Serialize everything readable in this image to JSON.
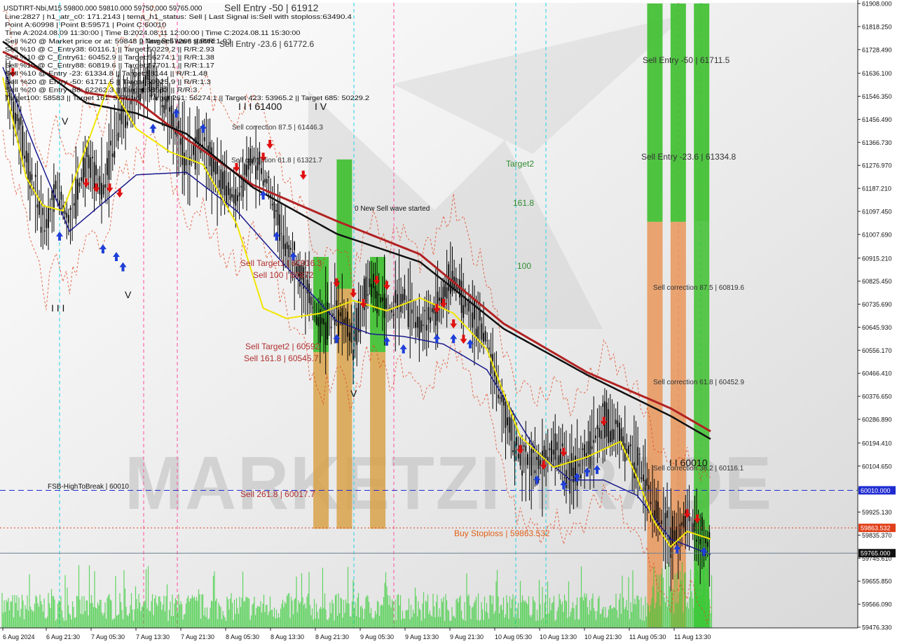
{
  "chart_data": {
    "type": "candlestick",
    "symbol": "USDTIRT-Nbi",
    "timeframe": "M15",
    "ohlc_header": "USDTIRT-Nbi,M15  59800.000 59810.000 59750.000 59765.000",
    "info_lines": [
      "Line:2827  | h1_atr_c0: 171.2143  | tema_h1_status: Sell  | Last Signal is:Sell with stoploss:63490.4",
      "Point A:60998  | Point B:59571  | Point C:60010",
      "Time A:2024.08.09 11:30:00  | Time B:2024.08.11 12:00:00  | Time C:2024.08.11 15:30:00",
      "Sell %20 @ Market price or at: 59848  || Target:57266  || R/R:1.93",
      "Sell %10 @ C_Entry38: 60116.1  || Target:50229.2  || R/R:2.93",
      "Sell %10 @ C_Entry61: 60452.9  || Target:56274.1  || R/R:1.38",
      "Sell %10 @ C_Entry88: 60819.6  || Target:57701.1  || R/R:1.17",
      "Sell %10 @ Entry -23: 61334.8  || Target:58144  || R/R:1.48",
      "Sell %20 @ Entry -50: 61711.5  || Target:59025.9  || R/R:1.3",
      "Sell %20 @ Entry -88: 62262.3  || Target:58583  || R/R:3",
      "Target100: 58583  || Target 161: 57701.1  || Target 261: 56274.1  || Target 423: 53965.2  || Target 685: 50229.2"
    ],
    "y_ticks": [
      "61908.000",
      "61818.250",
      "61728.490",
      "61636.100",
      "61546.350",
      "61456.490",
      "61366.730",
      "61276.970",
      "61187.210",
      "61097.450",
      "61007.690",
      "60915.210",
      "60825.450",
      "60735.690",
      "60645.930",
      "60556.170",
      "60466.410",
      "60376.650",
      "60286.890",
      "60194.410",
      "60104.650",
      "60014.890",
      "59925.130",
      "59835.370",
      "59745.610",
      "59655.850",
      "59566.090",
      "59476.330"
    ],
    "ylim": [
      59476.33,
      61908.0
    ],
    "x_ticks": [
      "6 Aug 2024",
      "6 Aug 21:30",
      "7 Aug 05:30",
      "7 Aug 13:30",
      "7 Aug 21:30",
      "8 Aug 05:30",
      "8 Aug 13:30",
      "8 Aug 21:30",
      "9 Aug 05:30",
      "9 Aug 13:30",
      "9 Aug 21:30",
      "10 Aug 05:30",
      "10 Aug 13:30",
      "10 Aug 21:30",
      "11 Aug 05:30",
      "11 Aug 13:30"
    ],
    "price_badges": [
      {
        "value": 60010.0,
        "label": "60010.000",
        "color": "#1f2bd1"
      },
      {
        "value": 59863.532,
        "label": "59863.532",
        "color": "#e0401a"
      },
      {
        "value": 59765.0,
        "label": "59765.000",
        "color": "#111111"
      }
    ],
    "horizontal_lines": [
      {
        "value": 60010.0,
        "color": "#1f2bd1",
        "style": "dashed"
      },
      {
        "value": 59863.532,
        "color": "#e0401a",
        "style": "dotted"
      },
      {
        "value": 59765.0,
        "color": "#6b7f8f",
        "style": "solid"
      }
    ],
    "price_path": [
      [
        0,
        61640
      ],
      [
        0.05,
        61420
      ],
      [
        0.1,
        61150
      ],
      [
        0.13,
        61020
      ],
      [
        0.16,
        61200
      ],
      [
        0.2,
        61050
      ],
      [
        0.25,
        61300
      ],
      [
        0.3,
        61180
      ],
      [
        0.35,
        61480
      ],
      [
        0.4,
        61550
      ],
      [
        0.45,
        61620
      ],
      [
        0.5,
        61480
      ],
      [
        0.55,
        61300
      ],
      [
        0.6,
        61360
      ],
      [
        0.65,
        61210
      ],
      [
        0.7,
        61150
      ],
      [
        0.75,
        61320
      ],
      [
        0.8,
        61180
      ],
      [
        0.85,
        60950
      ],
      [
        0.9,
        60820
      ],
      [
        0.95,
        60650
      ],
      [
        1.0,
        60720
      ],
      [
        1.05,
        60600
      ],
      [
        1.1,
        60830
      ],
      [
        1.15,
        60700
      ],
      [
        1.2,
        60760
      ],
      [
        1.25,
        60650
      ],
      [
        1.3,
        60720
      ],
      [
        1.35,
        60850
      ],
      [
        1.4,
        60700
      ],
      [
        1.45,
        60600
      ],
      [
        1.5,
        60320
      ],
      [
        1.55,
        60150
      ],
      [
        1.6,
        60100
      ],
      [
        1.65,
        60180
      ],
      [
        1.7,
        60080
      ],
      [
        1.75,
        60150
      ],
      [
        1.8,
        60280
      ],
      [
        1.85,
        60220
      ],
      [
        1.9,
        60120
      ],
      [
        1.95,
        59950
      ],
      [
        2.0,
        59820
      ],
      [
        2.05,
        59900
      ],
      [
        2.1,
        59810
      ],
      [
        2.12,
        59765
      ]
    ],
    "ma_black": [
      [
        0,
        61760
      ],
      [
        0.25,
        61520
      ],
      [
        0.4,
        61480
      ],
      [
        0.55,
        61400
      ],
      [
        0.75,
        61190
      ],
      [
        1.0,
        61010
      ],
      [
        1.25,
        60900
      ],
      [
        1.5,
        60640
      ],
      [
        1.75,
        60460
      ],
      [
        2.0,
        60300
      ],
      [
        2.12,
        60210
      ]
    ],
    "ma_red": [
      [
        0,
        61720
      ],
      [
        0.25,
        61560
      ],
      [
        0.4,
        61530
      ],
      [
        0.55,
        61380
      ],
      [
        0.75,
        61200
      ],
      [
        1.0,
        61060
      ],
      [
        1.25,
        60930
      ],
      [
        1.5,
        60660
      ],
      [
        1.75,
        60470
      ],
      [
        2.0,
        60330
      ],
      [
        2.12,
        60240
      ]
    ],
    "ma_navy": [
      [
        0,
        61660
      ],
      [
        0.1,
        61330
      ],
      [
        0.2,
        61020
      ],
      [
        0.3,
        61130
      ],
      [
        0.4,
        61240
      ],
      [
        0.55,
        61250
      ],
      [
        0.7,
        61100
      ],
      [
        0.85,
        60880
      ],
      [
        1.0,
        60670
      ],
      [
        1.1,
        60620
      ],
      [
        1.2,
        60610
      ],
      [
        1.32,
        60580
      ],
      [
        1.45,
        60480
      ],
      [
        1.6,
        60160
      ],
      [
        1.7,
        60050
      ],
      [
        1.8,
        60050
      ],
      [
        1.9,
        59990
      ],
      [
        2.0,
        59820
      ],
      [
        2.12,
        59760
      ]
    ],
    "ma_yellow": [
      [
        0,
        61620
      ],
      [
        0.07,
        61230
      ],
      [
        0.12,
        61120
      ],
      [
        0.18,
        61100
      ],
      [
        0.25,
        61350
      ],
      [
        0.32,
        61600
      ],
      [
        0.4,
        61420
      ],
      [
        0.5,
        61330
      ],
      [
        0.6,
        61280
      ],
      [
        0.7,
        61050
      ],
      [
        0.78,
        60720
      ],
      [
        0.85,
        60680
      ],
      [
        0.95,
        60700
      ],
      [
        1.05,
        60750
      ],
      [
        1.15,
        60710
      ],
      [
        1.25,
        60760
      ],
      [
        1.35,
        60700
      ],
      [
        1.45,
        60560
      ],
      [
        1.55,
        60220
      ],
      [
        1.65,
        60100
      ],
      [
        1.75,
        60140
      ],
      [
        1.85,
        60200
      ],
      [
        1.9,
        60060
      ],
      [
        1.95,
        59890
      ],
      [
        2.0,
        59790
      ],
      [
        2.05,
        59850
      ],
      [
        2.12,
        59820
      ]
    ],
    "zones": [
      {
        "x0": 0.93,
        "x1": 1.0,
        "v0": 59860,
        "v1": 60920,
        "colors": [
          "#3dbf2e",
          "#d8a24a"
        ]
      },
      {
        "x0": 1.0,
        "x1": 1.1,
        "v0": 59860,
        "v1": 61300,
        "colors": [
          "#3dbf2e",
          "#d8a24a"
        ]
      },
      {
        "x0": 1.1,
        "x1": 1.18,
        "v0": 59860,
        "v1": 60920,
        "colors": [
          "#3dbf2e",
          "#d8a24a"
        ]
      },
      {
        "x0": 1.93,
        "x1": 2.0,
        "v0": 59476,
        "v1": 61908,
        "colors": [
          "#3dbf2e",
          "#e8975a"
        ]
      },
      {
        "x0": 2.0,
        "x1": 2.07,
        "v0": 59476,
        "v1": 61908,
        "colors": [
          "#3dbf2e",
          "#e8975a"
        ]
      },
      {
        "x0": 2.07,
        "x1": 2.13,
        "v0": 59476,
        "v1": 61908,
        "colors": [
          "#3dbf2e",
          "#3dbf2e"
        ]
      }
    ],
    "annotations": [
      {
        "text": "Sell Entry -50 | 61912",
        "color": "#333333",
        "size": 14
      },
      {
        "text": "Sell Entry -23.6 | 61772.6",
        "color": "#333333",
        "size": 12
      },
      {
        "text": "I I I 61400",
        "color": "#111111",
        "size": 14
      },
      {
        "text": "I V",
        "color": "#111111",
        "size": 14
      },
      {
        "text": "Sell correction 87.5 | 61446.3",
        "color": "#333333",
        "size": 10
      },
      {
        "text": "Sell correction 61.8 | 61321.7",
        "color": "#333333",
        "size": 10
      },
      {
        "text": "0 New Sell wave started",
        "color": "#111111",
        "size": 10
      },
      {
        "text": "0 New Sell wave started",
        "color": "#111111",
        "size": 10
      },
      {
        "text": "Target2",
        "color": "#2e8b2e",
        "size": 12
      },
      {
        "text": "161.8",
        "color": "#2e8b2e",
        "size": 12
      },
      {
        "text": "100",
        "color": "#2e8b2e",
        "size": 12
      },
      {
        "text": "Sell Target1 | 60916.3",
        "color": "#b03030",
        "size": 12
      },
      {
        "text": "Sell 100 | 60872",
        "color": "#b03030",
        "size": 12
      },
      {
        "text": "Sell Target2 | 60592",
        "color": "#b03030",
        "size": 12
      },
      {
        "text": "Sell 161.8 | 60545.7",
        "color": "#b03030",
        "size": 12
      },
      {
        "text": "Sell 261.8 | 60017.7",
        "color": "#b03030",
        "size": 12
      },
      {
        "text": "Buy Stoploss | 59863.532",
        "color": "#e0601a",
        "size": 12
      },
      {
        "text": "FSB-HighToBreak | 60010",
        "color": "#111111",
        "size": 10
      },
      {
        "text": "Sell Entry -50 | 61711.5",
        "color": "#333333",
        "size": 12
      },
      {
        "text": "Sell Entry -23.6 | 61334.8",
        "color": "#333333",
        "size": 12
      },
      {
        "text": "Sell correction 87.5 | 60819.6",
        "color": "#333333",
        "size": 10
      },
      {
        "text": "Sell correction 61.8 | 60452.9",
        "color": "#333333",
        "size": 10
      },
      {
        "text": "Sell correction 38.2 | 60116.1",
        "color": "#333333",
        "size": 10
      },
      {
        "text": "I I 60010",
        "color": "#111111",
        "size": 14
      },
      {
        "text": "I I I",
        "color": "#111111",
        "size": 14
      },
      {
        "text": "V",
        "color": "#111111",
        "size": 14
      },
      {
        "text": "V",
        "color": "#111111",
        "size": 14
      },
      {
        "text": "V",
        "color": "#111111",
        "size": 14
      }
    ],
    "watermark": "MARKETZI TRADE",
    "colors": {
      "candle": "#000000",
      "ma_black": "#111111",
      "ma_red": "#b22222",
      "ma_navy": "#1a1a8c",
      "ma_yellow": "#f2e600",
      "volume": "#33cc33",
      "vline_pink": "#ff4fa0",
      "vline_cyan": "#22d3e6",
      "buy_arrow": "#1f3fd8",
      "sell_arrow": "#e01010",
      "envelope": "#e0401a"
    }
  }
}
